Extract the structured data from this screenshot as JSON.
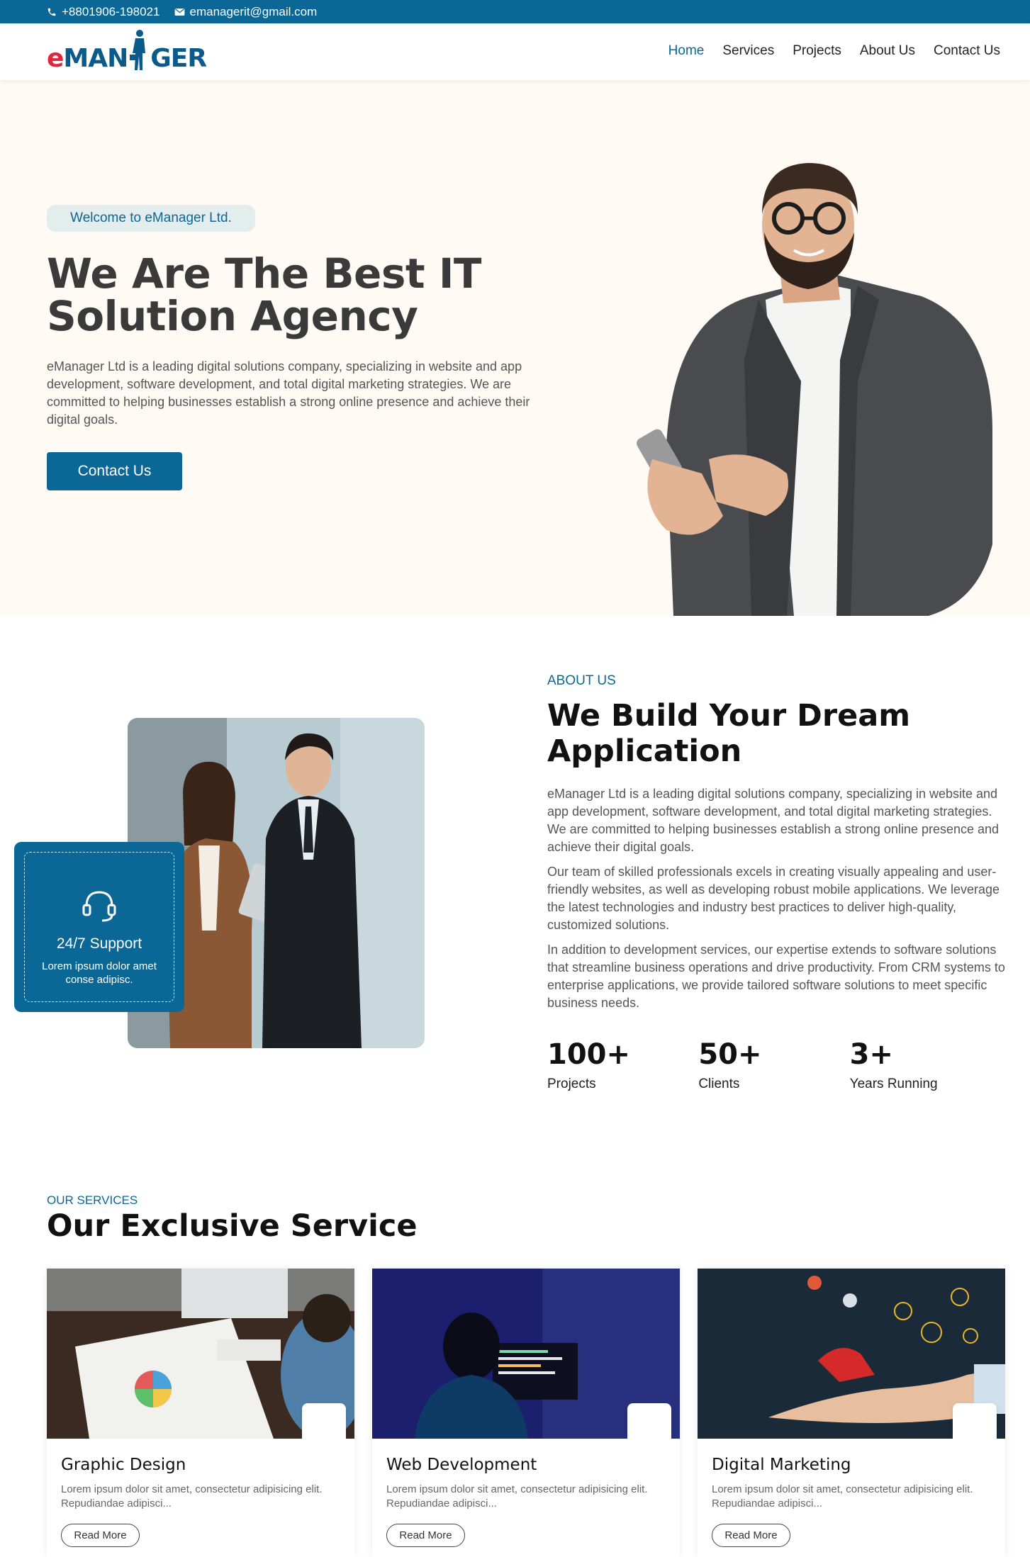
{
  "topbar": {
    "phone": "+8801906-198021",
    "email": "emanagerit@gmail.com"
  },
  "logo": {
    "part1": "e",
    "part2": "MAN",
    "part3": "GER"
  },
  "nav": {
    "items": [
      "Home",
      "Services",
      "Projects",
      "About Us",
      "Contact Us"
    ],
    "active": "Home"
  },
  "hero": {
    "badge": "Welcome to eManager Ltd.",
    "title_line1": "We Are The Best IT",
    "title_line2": "Solution Agency",
    "description": "eManager Ltd is a leading digital solutions company, specializing in website and app development, software development, and total digital marketing strategies. We are committed to helping businesses establish a strong online presence and achieve their digital goals.",
    "cta": "Contact Us"
  },
  "about": {
    "label": "ABOUT US",
    "title": "We Build Your Dream Application",
    "paragraphs": [
      "eManager Ltd is a leading digital solutions company, specializing in website and app development, software development, and total digital marketing strategies. We are committed to helping businesses establish a strong online presence and achieve their digital goals.",
      "Our team of skilled professionals excels in creating visually appealing and user-friendly websites, as well as developing robust mobile applications. We leverage the latest technologies and industry best practices to deliver high-quality, customized solutions.",
      "In addition to development services, our expertise extends to software solutions that streamline business operations and drive productivity. From CRM systems to enterprise applications, we provide tailored software solutions to meet specific business needs."
    ],
    "support": {
      "title": "24/7 Support",
      "desc": "Lorem ipsum dolor amet conse adipisc."
    },
    "stats": [
      {
        "num": "100+",
        "label": "Projects"
      },
      {
        "num": "50+",
        "label": "Clients"
      },
      {
        "num": "3+",
        "label": "Years Running"
      }
    ]
  },
  "services": {
    "label": "OUR SERVICES",
    "title": "Our Exclusive Service",
    "cards": [
      {
        "title": "Graphic Design",
        "desc": "Lorem ipsum dolor sit amet, consectetur adipisicing elit. Repudiandae adipisci...",
        "button": "Read More"
      },
      {
        "title": "Web Development",
        "desc": "Lorem ipsum dolor sit amet, consectetur adipisicing elit. Repudiandae adipisci...",
        "button": "Read More"
      },
      {
        "title": "Digital Marketing",
        "desc": "Lorem ipsum dolor sit amet, consectetur adipisicing elit. Repudiandae adipisci...",
        "button": "Read More"
      }
    ]
  },
  "colors": {
    "brand": "#0a6796",
    "logo_red": "#e0253c",
    "hero_bg": "#fffbf4"
  }
}
